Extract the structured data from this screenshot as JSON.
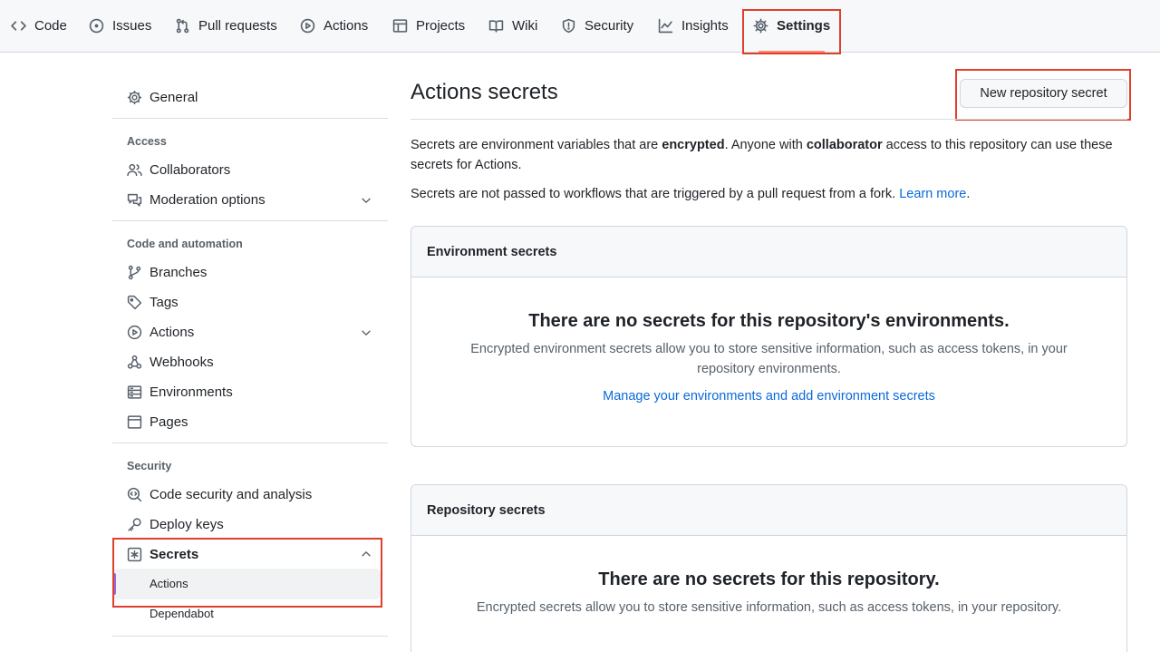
{
  "topnav": {
    "tabs": [
      {
        "label": "Code",
        "icon": "code-icon"
      },
      {
        "label": "Issues",
        "icon": "issue-opened-icon"
      },
      {
        "label": "Pull requests",
        "icon": "git-pull-request-icon"
      },
      {
        "label": "Actions",
        "icon": "play-icon"
      },
      {
        "label": "Projects",
        "icon": "table-icon"
      },
      {
        "label": "Wiki",
        "icon": "book-icon"
      },
      {
        "label": "Security",
        "icon": "shield-icon"
      },
      {
        "label": "Insights",
        "icon": "graph-icon"
      },
      {
        "label": "Settings",
        "icon": "gear-icon",
        "active": true
      }
    ]
  },
  "sidebar": {
    "general": "General",
    "sections": {
      "access": {
        "heading": "Access",
        "items": [
          "Collaborators",
          "Moderation options"
        ]
      },
      "code_automation": {
        "heading": "Code and automation",
        "items": [
          "Branches",
          "Tags",
          "Actions",
          "Webhooks",
          "Environments",
          "Pages"
        ]
      },
      "security": {
        "heading": "Security",
        "items": [
          "Code security and analysis",
          "Deploy keys",
          "Secrets"
        ],
        "secrets_subitems": [
          "Actions",
          "Dependabot"
        ],
        "active_subitem": "Actions"
      }
    }
  },
  "main": {
    "title": "Actions secrets",
    "new_secret_button": "New repository secret",
    "intro": {
      "p1_a": "Secrets are environment variables that are ",
      "p1_b": "encrypted",
      "p1_c": ". Anyone with ",
      "p1_d": "collaborator",
      "p1_e": " access to this repository can use these secrets for Actions.",
      "p2_a": "Secrets are not passed to workflows that are triggered by a pull request from a fork. ",
      "p2_link": "Learn more",
      "p2_end": "."
    },
    "environment_secrets": {
      "header": "Environment secrets",
      "blank_title": "There are no secrets for this repository's environments.",
      "blank_desc": "Encrypted environment secrets allow you to store sensitive information, such as access tokens, in your repository environments.",
      "link": "Manage your environments and add environment secrets"
    },
    "repository_secrets": {
      "header": "Repository secrets",
      "blank_title": "There are no secrets for this repository.",
      "blank_desc": "Encrypted secrets allow you to store sensitive information, such as access tokens, in your repository."
    }
  },
  "colors": {
    "accent_link": "#0969da",
    "highlight_box": "#e0402b",
    "active_tab_underline": "#fd8c73"
  }
}
